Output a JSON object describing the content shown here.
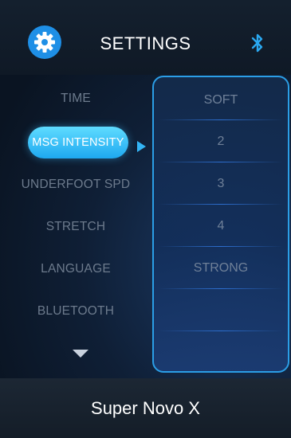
{
  "header": {
    "title": "SETTINGS"
  },
  "menu": {
    "items": [
      {
        "label": "TIME",
        "active": false
      },
      {
        "label": "MSG INTENSITY",
        "active": true
      },
      {
        "label": "UNDERFOOT SPD",
        "active": false
      },
      {
        "label": "STRETCH",
        "active": false
      },
      {
        "label": "LANGUAGE",
        "active": false
      },
      {
        "label": "BLUETOOTH",
        "active": false
      }
    ]
  },
  "intensity": {
    "options": [
      "SOFT",
      "2",
      "3",
      "4",
      "STRONG"
    ]
  },
  "footer": {
    "model": "Super Novo X"
  },
  "colors": {
    "accent": "#1ea8f0",
    "panel_border": "#2b9ee6",
    "inactive_text": "#6d7b8d"
  },
  "icons": [
    "gear-icon",
    "bluetooth-icon",
    "pointer-arrow-icon",
    "scroll-down-icon"
  ]
}
